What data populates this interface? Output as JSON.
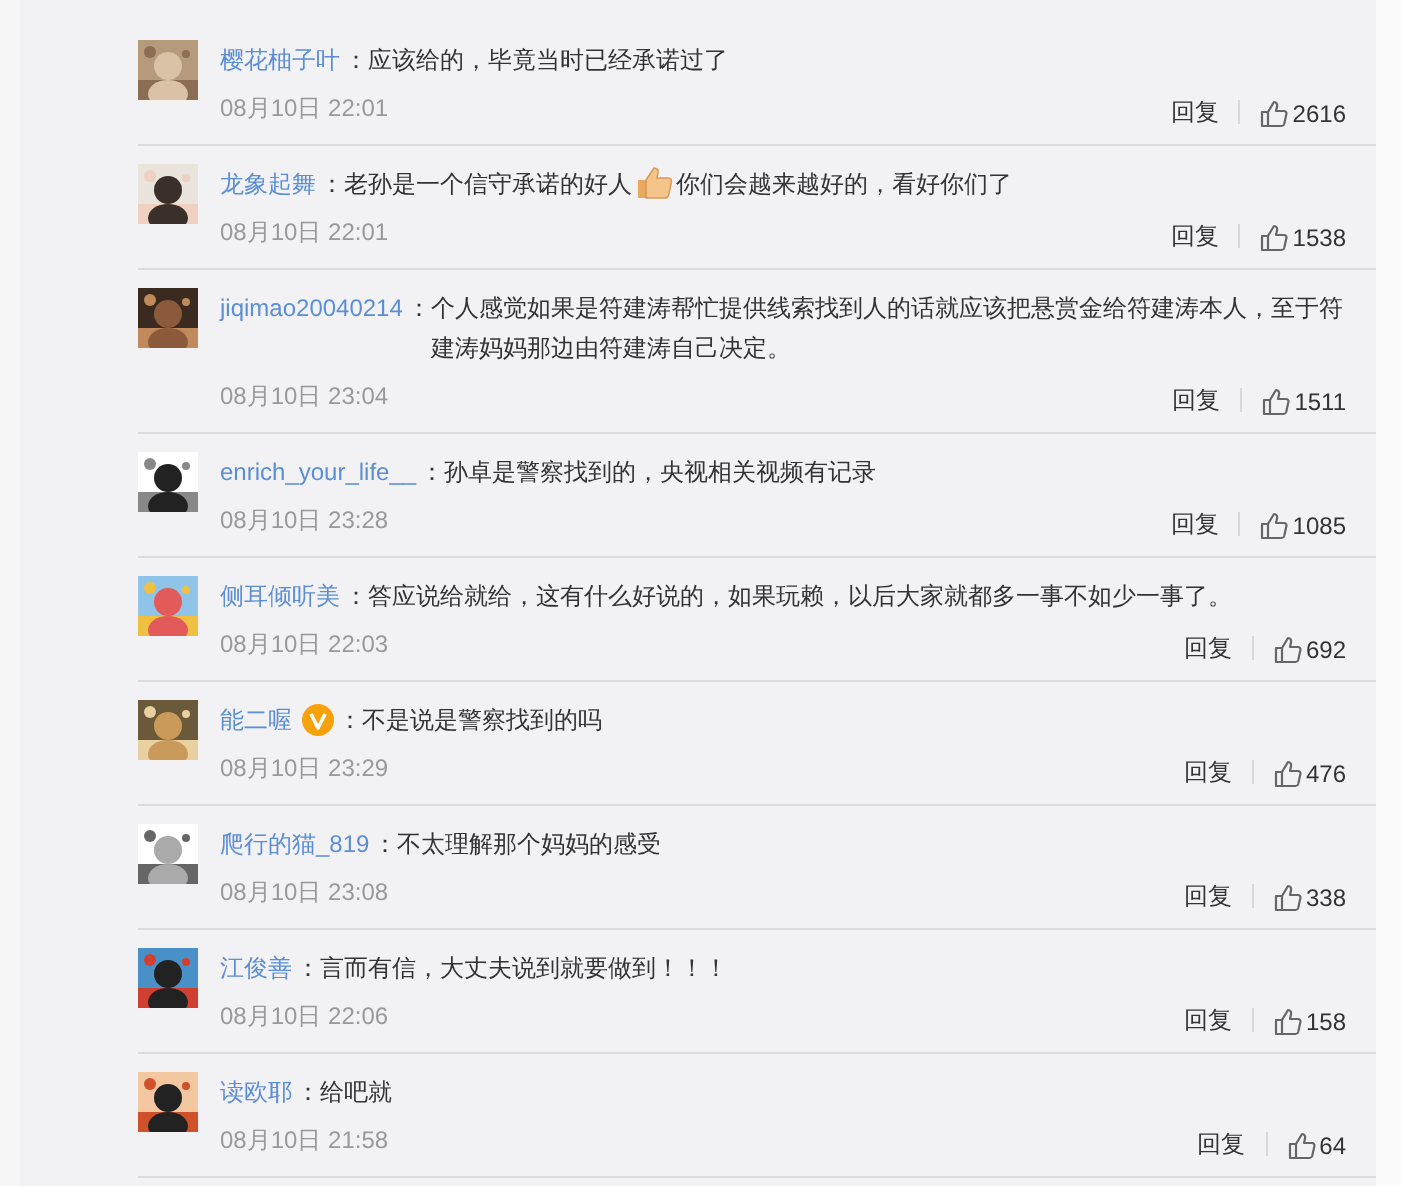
{
  "separator": "：",
  "comments": [
    {
      "user": "樱花柚子叶",
      "verified": false,
      "parts": [
        {
          "kind": "text",
          "text": "应该给的，毕竟当时已经承诺过了"
        }
      ],
      "time": "08月10日 22:01",
      "reply": "回复",
      "likes": "2616"
    },
    {
      "user": "龙象起舞",
      "verified": false,
      "parts": [
        {
          "kind": "text",
          "text": "老孙是一个信守承诺的好人"
        },
        {
          "kind": "emoji"
        },
        {
          "kind": "text",
          "text": "你们会越来越好的，看好你们了"
        }
      ],
      "time": "08月10日 22:01",
      "reply": "回复",
      "likes": "1538"
    },
    {
      "user": "jiqimao20040214",
      "verified": false,
      "parts": [
        {
          "kind": "text",
          "text": "个人感觉如果是符建涛帮忙提供线索找到人的话就应该把悬赏金给符建涛本人，至于符建涛妈妈那边由符建涛自己决定。"
        }
      ],
      "time": "08月10日 23:04",
      "reply": "回复",
      "likes": "1511"
    },
    {
      "user": "enrich_your_life__",
      "verified": false,
      "parts": [
        {
          "kind": "text",
          "text": "孙卓是警察找到的，央视相关视频有记录"
        }
      ],
      "time": "08月10日 23:28",
      "reply": "回复",
      "likes": "1085"
    },
    {
      "user": "侧耳倾听美",
      "verified": false,
      "parts": [
        {
          "kind": "text",
          "text": "答应说给就给，这有什么好说的，如果玩赖，以后大家就都多一事不如少一事了。"
        }
      ],
      "time": "08月10日 22:03",
      "reply": "回复",
      "likes": "692"
    },
    {
      "user": "能二喔",
      "verified": true,
      "parts": [
        {
          "kind": "text",
          "text": "不是说是警察找到的吗"
        }
      ],
      "time": "08月10日 23:29",
      "reply": "回复",
      "likes": "476"
    },
    {
      "user": "爬行的猫_819",
      "verified": false,
      "parts": [
        {
          "kind": "text",
          "text": "不太理解那个妈妈的感受"
        }
      ],
      "time": "08月10日 23:08",
      "reply": "回复",
      "likes": "338"
    },
    {
      "user": "江俊善",
      "verified": false,
      "parts": [
        {
          "kind": "text",
          "text": "言而有信，大丈夫说到就要做到！！！"
        }
      ],
      "time": "08月10日 22:06",
      "reply": "回复",
      "likes": "158"
    },
    {
      "user": "读欧耶",
      "verified": false,
      "parts": [
        {
          "kind": "text",
          "text": "给吧就"
        }
      ],
      "time": "08月10日 21:58",
      "reply": "回复",
      "likes": "64"
    }
  ]
}
